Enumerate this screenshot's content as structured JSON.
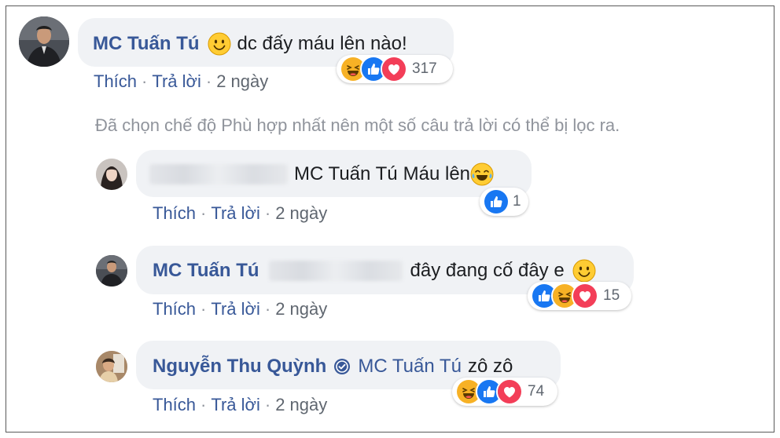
{
  "comment": {
    "author": "MC Tuấn Tú",
    "text": "dc đấy máu lên nào!",
    "actions": {
      "like": "Thích",
      "reply": "Trả lời",
      "time": "2 ngày"
    },
    "reactions": {
      "icons": [
        "haha-icon",
        "like-icon",
        "love-icon"
      ],
      "count": "317"
    }
  },
  "filter_note": "Đã chọn chế độ Phù hợp nhất nên một số câu trả lời có thể bị lọc ra.",
  "replies": [
    {
      "author": "",
      "tag": "MC Tuấn Tú",
      "text": "Máu lên",
      "actions": {
        "like": "Thích",
        "reply": "Trả lời",
        "time": "2 ngày"
      },
      "reactions": {
        "icons": [
          "like-icon"
        ],
        "count": "1"
      }
    },
    {
      "author": "MC Tuấn Tú",
      "text": "đây đang cố đây e",
      "actions": {
        "like": "Thích",
        "reply": "Trả lời",
        "time": "2 ngày"
      },
      "reactions": {
        "icons": [
          "like-icon",
          "haha-icon",
          "love-icon"
        ],
        "count": "15"
      }
    },
    {
      "author": "Nguyễn Thu Quỳnh",
      "tag": "MC Tuấn Tú",
      "text": "zô zô",
      "actions": {
        "like": "Thích",
        "reply": "Trả lời",
        "time": "2 ngày"
      },
      "reactions": {
        "icons": [
          "haha-icon",
          "like-icon",
          "love-icon"
        ],
        "count": "74"
      }
    }
  ],
  "colors": {
    "name": "#385898",
    "bubble": "#f0f2f5",
    "muted": "#90949c",
    "like": "#1877f2",
    "love": "#f33e58",
    "haha": "#f7b125"
  }
}
